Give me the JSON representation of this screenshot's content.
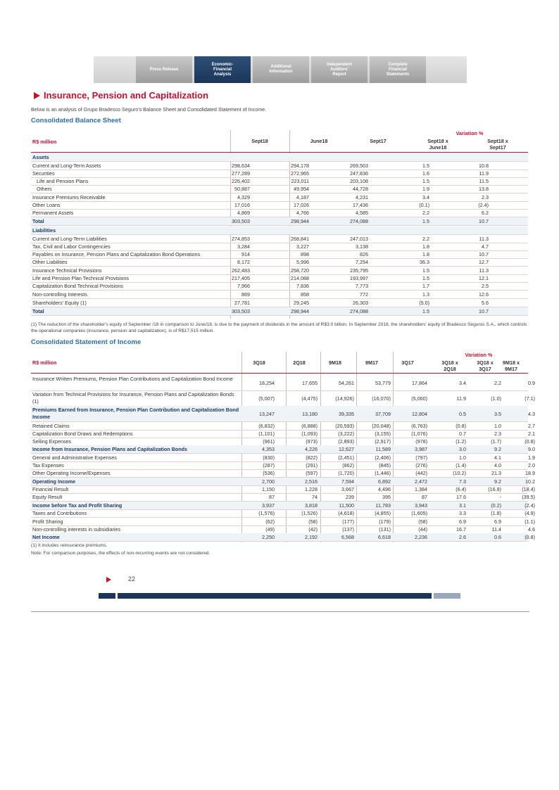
{
  "nav": {
    "tabs": [
      {
        "label": "Press Release"
      },
      {
        "label": "Economic-\nFinancial\nAnalysis"
      },
      {
        "label": "Additional\nInformation"
      },
      {
        "label": "Independent\nAuditors'\nReport"
      },
      {
        "label": "Complete\nFinancial\nStatements"
      }
    ]
  },
  "page": {
    "title": "Insurance, Pension and Capitalization",
    "intro": "Below is an analysis of Grupo Bradesco Seguro's Balance Sheet and Consolidated Statement of Income.",
    "page_number": "22"
  },
  "balance": {
    "heading": "Consolidated Balance Sheet",
    "variation": "Variation %",
    "cols": [
      "Sept18",
      "June18",
      "Sept17",
      "Sept18 x\nJune18",
      "Sept18 x\nSept17"
    ],
    "unit": "R$ million",
    "rows": [
      {
        "label": "Assets",
        "bold": true,
        "v": [
          "",
          "",
          "",
          "",
          ""
        ]
      },
      {
        "label": "Current and Long-Term Assets",
        "v": [
          "298,634",
          "294,178",
          "269,503",
          "1.5",
          "10.8"
        ]
      },
      {
        "label": "Securities",
        "v": [
          "277,289",
          "272,965",
          "247,836",
          "1.6",
          "11.9"
        ]
      },
      {
        "label": "Life and Pension Plans",
        "v": [
          "226,402",
          "223,011",
          "203,108",
          "1.5",
          "11.5"
        ]
      },
      {
        "label": "Others",
        "v": [
          "50,887",
          "49,954",
          "44,728",
          "1.9",
          "13.8"
        ]
      },
      {
        "label": "Insurance Premiums Receivable",
        "v": [
          "4,329",
          "4,187",
          "4,231",
          "3.4",
          "2.3"
        ]
      },
      {
        "label": "Other Loans",
        "v": [
          "17,016",
          "17,026",
          "17,436",
          "(0.1)",
          "(2.4)"
        ]
      },
      {
        "label": "Permanent Assets",
        "v": [
          "4,869",
          "4,766",
          "4,585",
          "2.2",
          "6.2"
        ]
      },
      {
        "label": "Total",
        "bold": true,
        "v": [
          "303,503",
          "298,944",
          "274,088",
          "1.5",
          "10.7"
        ]
      },
      {
        "label": "Liabilities",
        "bold": true,
        "v": [
          "",
          "",
          "",
          "",
          ""
        ]
      },
      {
        "label": "Current and Long-Term Liabilities",
        "v": [
          "274,853",
          "268,841",
          "247,013",
          "2.2",
          "11.3"
        ]
      },
      {
        "label": "Tax, Civil and Labor Contingencies",
        "v": [
          "3,284",
          "3,227",
          "3,138",
          "1.8",
          "4.7"
        ]
      },
      {
        "label": "Payables on Insurance, Pension Plans and Capitalization Bond Operations",
        "v": [
          "914",
          "898",
          "826",
          "1.8",
          "10.7"
        ]
      },
      {
        "label": "Other Liabilities",
        "v": [
          "8,172",
          "5,996",
          "7,254",
          "36.3",
          "12.7"
        ]
      },
      {
        "label": "Insurance Technical Provisions",
        "v": [
          "262,483",
          "258,720",
          "235,795",
          "1.5",
          "11.3"
        ]
      },
      {
        "label": "Life and Pension Plan Technical Provisions",
        "v": [
          "217,405",
          "214,088",
          "193,997",
          "1.5",
          "12.1"
        ]
      },
      {
        "label": "Capitalization Bond Technical Provisions",
        "v": [
          "7,966",
          "7,836",
          "7,773",
          "1.7",
          "2.5"
        ]
      },
      {
        "label": "Non-controlling Interests",
        "v": [
          "869",
          "858",
          "772",
          "1.3",
          "12.6"
        ]
      },
      {
        "label": "Shareholders' Equity (1)",
        "v": [
          "27,781",
          "29,245",
          "26,303",
          "(5.0)",
          "5.6"
        ]
      },
      {
        "label": "Total",
        "bold": true,
        "v": [
          "303,503",
          "298,944",
          "274,088",
          "1.5",
          "10.7"
        ]
      }
    ],
    "note": "(1) The reduction of the shareholder's equity of September /18 in comparison to June/18, is due to the payment of dividends in the amount of R$3.0 billion. In September 2018, the shareholders' equity of Bradesco Seguros S.A., which controls the operational companies (insurance, pension and capitalization), is of R$17,515 million."
  },
  "income": {
    "heading": "Consolidated Statement of Income",
    "variation": "Variation %",
    "cols": [
      "3Q18",
      "2Q18",
      "9M18",
      "9M17",
      "3Q17",
      "3Q18 x\n2Q18",
      "3Q18 x\n3Q17",
      "9M18 x\n9M17"
    ],
    "unit": "R$ million",
    "rows": [
      {
        "label": "Insurance Written Premiums, Pension Plan Contributions and Capitalization Bond Income",
        "h": 2,
        "v": [
          "18,254",
          "17,655",
          "54,261",
          "53,779",
          "17,864",
          "3.4",
          "2.2",
          "0.9"
        ]
      },
      {
        "label": "Variation from Technical Provisions for Insurance, Pension Plans and Capitalization Bonds (1)",
        "h": 2,
        "v": [
          "(5,007)",
          "(4,475)",
          "(14,926)",
          "(16,070)",
          "(5,060)",
          "11.9",
          "(1.0)",
          "(7.1)"
        ]
      },
      {
        "label": "Premiums Earned from Insurance, Pension Plan Contribution and Capitalization Bond Income",
        "h": 2,
        "bold": true,
        "v": [
          "13,247",
          "13,180",
          "39,335",
          "37,709",
          "12,804",
          "0.5",
          "3.5",
          "4.3"
        ]
      },
      {
        "label": "Retained Claims",
        "v": [
          "(6,832)",
          "(6,888)",
          "(20,593)",
          "(20,048)",
          "(6,763)",
          "(0.8)",
          "1.0",
          "2.7"
        ]
      },
      {
        "label": "Capitalization Bond Draws and Redemptions",
        "v": [
          "(1,101)",
          "(1,093)",
          "(3,222)",
          "(3,155)",
          "(1,076)",
          "0.7",
          "2.3",
          "2.1"
        ]
      },
      {
        "label": "Selling Expenses",
        "v": [
          "(961)",
          "(973)",
          "(2,893)",
          "(2,917)",
          "(978)",
          "(1.2)",
          "(1.7)",
          "(0.8)"
        ]
      },
      {
        "label": "Income from Insurance, Pension Plans and Capitalization Bonds",
        "bold": true,
        "v": [
          "4,353",
          "4,226",
          "12,627",
          "11,589",
          "3,987",
          "3.0",
          "9.2",
          "9.0"
        ]
      },
      {
        "label": "General and Administrative Expenses",
        "v": [
          "(830)",
          "(822)",
          "(2,451)",
          "(2,406)",
          "(797)",
          "1.0",
          "4.1",
          "1.9"
        ]
      },
      {
        "label": "Tax Expenses",
        "v": [
          "(287)",
          "(291)",
          "(862)",
          "(845)",
          "(276)",
          "(1.4)",
          "4.0",
          "2.0"
        ]
      },
      {
        "label": "Other Operating Income/Expenses",
        "v": [
          "(536)",
          "(597)",
          "(1,720)",
          "(1,446)",
          "(442)",
          "(10.2)",
          "21.3",
          "18.9"
        ]
      },
      {
        "label": "Operating Income",
        "bold": true,
        "v": [
          "2,700",
          "2,516",
          "7,594",
          "6,892",
          "2,472",
          "7.3",
          "9.2",
          "10.2"
        ]
      },
      {
        "label": "Financial Result",
        "v": [
          "1,150",
          "1,228",
          "3,667",
          "4,496",
          "1,384",
          "(6.4)",
          "(16.9)",
          "(18.4)"
        ]
      },
      {
        "label": "Equity Result",
        "v": [
          "87",
          "74",
          "239",
          "395",
          "87",
          "17.6",
          "-",
          "(39.5)"
        ]
      },
      {
        "label": "Income before Tax and Profit Sharing",
        "bold": true,
        "v": [
          "3,937",
          "3,818",
          "11,500",
          "11,783",
          "3,943",
          "3.1",
          "(0.2)",
          "(2.4)"
        ]
      },
      {
        "label": "Taxes and Contributions",
        "v": [
          "(1,576)",
          "(1,526)",
          "(4,618)",
          "(4,855)",
          "(1,605)",
          "3.3",
          "(1.8)",
          "(4.9)"
        ]
      },
      {
        "label": "Profit Sharing",
        "v": [
          "(62)",
          "(58)",
          "(177)",
          "(179)",
          "(58)",
          "6.9",
          "6.9",
          "(1.1)"
        ]
      },
      {
        "label": "Non-controlling interests in subsidiaries",
        "v": [
          "(49)",
          "(42)",
          "(137)",
          "(131)",
          "(44)",
          "16.7",
          "11.4",
          "4.6"
        ]
      },
      {
        "label": "Net Income",
        "bold": true,
        "v": [
          "2,250",
          "2,192",
          "6,568",
          "6,618",
          "2,236",
          "2.6",
          "0.6",
          "(0.8)"
        ]
      }
    ],
    "notes": [
      "(1) It includes reinsurance premiums.",
      "Note: For comparison purposes, the effects of non-recurring events are not considered."
    ]
  },
  "colors": {
    "accent": "#c8102e",
    "heading": "#2e6ea8",
    "nav_active": "#1a3558"
  }
}
